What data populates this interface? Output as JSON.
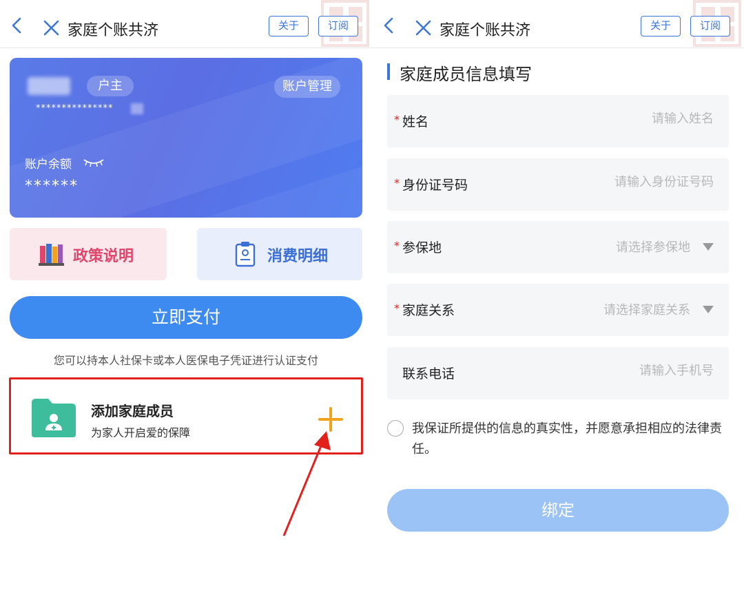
{
  "left": {
    "navbar": {
      "title": "家庭个账共济",
      "about_label": "关于",
      "subscribe_label": "订阅"
    },
    "card": {
      "role_badge": "户主",
      "manage_label": "账户管理",
      "card_number_masked": "***************",
      "balance_label": "账户余额",
      "balance_value": "******"
    },
    "tiles": {
      "policy_label": "政策说明",
      "detail_label": "消费明细"
    },
    "pay": {
      "button_label": "立即支付",
      "hint": "您可以持本人社保卡或本人医保电子凭证进行认证支付"
    },
    "add_member": {
      "title": "添加家庭成员",
      "subtitle": "为家人开启爱的保障"
    }
  },
  "right": {
    "navbar": {
      "title": "家庭个账共济",
      "about_label": "关于",
      "subscribe_label": "订阅"
    },
    "form": {
      "section_title": "家庭成员信息填写",
      "fields": [
        {
          "required_mark": "*",
          "label": "姓名",
          "placeholder": "请输入姓名"
        },
        {
          "required_mark": "*",
          "label": "身份证号码",
          "placeholder": "请输入身份证号码"
        },
        {
          "required_mark": "*",
          "label": "参保地",
          "placeholder": "请选择参保地"
        },
        {
          "required_mark": "*",
          "label": "家庭关系",
          "placeholder": "请选择家庭关系"
        },
        {
          "required_mark": "",
          "label": "联系电话",
          "placeholder": "请输入手机号"
        }
      ],
      "agreement": "我保证所提供的信息的真实性，并愿意承担相应的法律责任。",
      "submit_label": "绑定"
    }
  },
  "colors": {
    "accent": "#3d8af0",
    "highlight_border": "#e2211c",
    "policy_text": "#e0456b",
    "detail_text": "#3b6fd6",
    "plus": "#f2a31b",
    "disabled_button": "#9cc3f5"
  },
  "icons": {
    "back": "chevron-left-icon",
    "close": "close-icon",
    "eye": "eye-closed-icon",
    "policy": "books-icon",
    "detail": "clipboard-icon",
    "add_member": "folder-user-icon",
    "plus": "plus-icon",
    "dropdown": "caret-down-icon",
    "arrow": "red-arrow-annotation"
  }
}
